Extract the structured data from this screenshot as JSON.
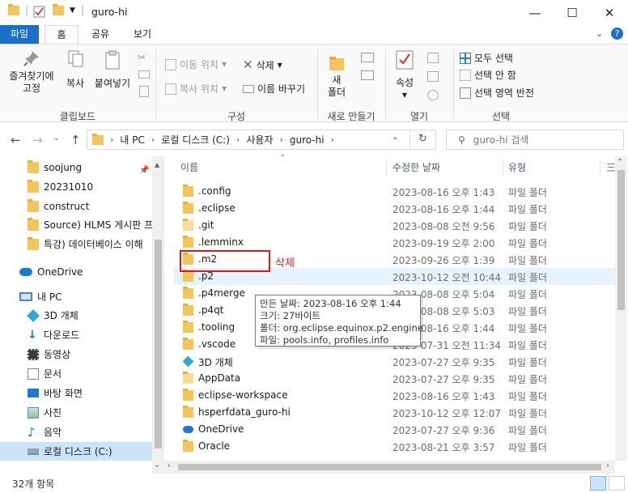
{
  "window": {
    "title": "guro-hi",
    "minimize": "—",
    "maximize": "☐",
    "close": "✕"
  },
  "tabs": {
    "file": "파일",
    "home": "홈",
    "share": "공유",
    "view": "보기"
  },
  "ribbon": {
    "clipboard": {
      "pin_label": "즐겨찾기에\n고정",
      "copy": "복사",
      "paste": "붙여넣기",
      "group": "클립보드"
    },
    "organize": {
      "move_to": "이동 위치",
      "copy_to": "복사 위치",
      "delete": "삭제",
      "rename": "이름 바꾸기",
      "group": "구성"
    },
    "new": {
      "new_folder": "새\n폴더",
      "group": "새로 만들기"
    },
    "open": {
      "properties": "속성",
      "group": "열기"
    },
    "select": {
      "select_all": "모두 선택",
      "select_none": "선택 안 함",
      "invert": "선택 영역 반전",
      "group": "선택"
    }
  },
  "address": {
    "crumbs": [
      "내 PC",
      "로컬 디스크 (C:)",
      "사용자",
      "guro-hi"
    ],
    "search_placeholder": "guro-hi 검색"
  },
  "navpane": {
    "quick_access": [
      {
        "label": "soojung",
        "pinned": true
      },
      {
        "label": "20231010"
      },
      {
        "label": "construct"
      },
      {
        "label": "Source) HLMS 게시판 프"
      },
      {
        "label": "특강) 데이터베이스 이해"
      }
    ],
    "onedrive": "OneDrive",
    "this_pc": "내 PC",
    "pc_items": [
      "3D 개체",
      "다운로드",
      "동영상",
      "문서",
      "바탕 화면",
      "사진",
      "음악",
      "로컬 디스크 (C:)"
    ]
  },
  "columns": {
    "name": "이름",
    "date": "수정한 날짜",
    "type": "유형",
    "more": "三"
  },
  "files": [
    {
      "name": ".config",
      "date": "2023-08-16 오후 1:43",
      "type": "파일 폴더"
    },
    {
      "name": ".eclipse",
      "date": "2023-08-16 오후 1:44",
      "type": "파일 폴더"
    },
    {
      "name": ".git",
      "date": "2023-08-08 오전 9:56",
      "type": "파일 폴더"
    },
    {
      "name": ".lemminx",
      "date": "2023-09-19 오후 2:00",
      "type": "파일 폴더"
    },
    {
      "name": ".m2",
      "date": "2023-09-26 오후 1:39",
      "type": "파일 폴더"
    },
    {
      "name": ".p2",
      "date": "2023-10-12 오전 10:44",
      "type": "파일 폴더"
    },
    {
      "name": ".p4merge",
      "date": "2023-08-08 오후 5:04",
      "type": "파일 폴더"
    },
    {
      "name": ".p4qt",
      "date": "2023-08-08 오후 5:03",
      "type": "파일 폴더"
    },
    {
      "name": ".tooling",
      "date": "2023-08-16 오후 1:44",
      "type": "파일 폴더"
    },
    {
      "name": ".vscode",
      "date": "2023-07-31 오전 11:34",
      "type": "파일 폴더"
    },
    {
      "name": "3D 개체",
      "date": "2023-07-27 오후 9:35",
      "type": "파일 폴더"
    },
    {
      "name": "AppData",
      "date": "2023-07-27 오후 9:35",
      "type": "파일 폴더"
    },
    {
      "name": "eclipse-workspace",
      "date": "2023-08-16 오후 1:43",
      "type": "파일 폴더"
    },
    {
      "name": "hsperfdata_guro-hi",
      "date": "2023-10-12 오후 12:07",
      "type": "파일 폴더"
    },
    {
      "name": "OneDrive",
      "date": "2023-07-27 오후 9:36",
      "type": "파일 폴더"
    },
    {
      "name": "Oracle",
      "date": "2023-08-21 오후 3:57",
      "type": "파일 폴더"
    }
  ],
  "annotation": {
    "label": "삭제"
  },
  "tooltip": {
    "line1": "만든 날짜: 2023-08-16 오후 1:44",
    "line2": "크기: 27바이트",
    "line3": "폴더: org.eclipse.equinox.p2.engine",
    "line4": "파일: pools.info, profiles.info"
  },
  "status": {
    "count": "32개 항목"
  },
  "colors": {
    "accent": "#1a6fc9",
    "annotation": "#e0161b",
    "folder": "#f4c55c",
    "selected": "#cce4f7"
  }
}
